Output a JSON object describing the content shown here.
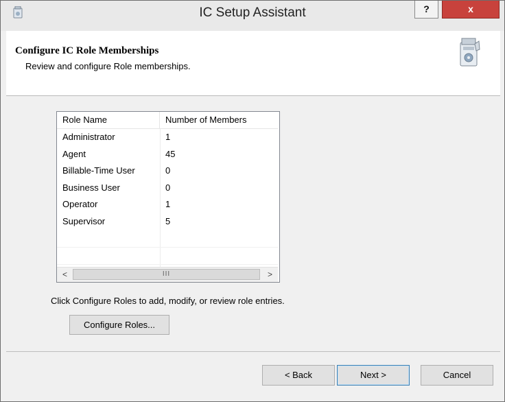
{
  "window": {
    "title": "IC Setup Assistant",
    "help_label": "?",
    "close_label": "x"
  },
  "header": {
    "title": "Configure IC Role Memberships",
    "subtitle": "Review and configure Role memberships."
  },
  "table": {
    "columns": [
      "Role Name",
      "Number of Members"
    ],
    "rows": [
      [
        "Administrator",
        "1"
      ],
      [
        "Agent",
        "45"
      ],
      [
        "Billable-Time User",
        "0"
      ],
      [
        "Business User",
        "0"
      ],
      [
        "Operator",
        "1"
      ],
      [
        "Supervisor",
        "5"
      ]
    ],
    "scroll_left": "<",
    "scroll_right": ">",
    "scroll_thumb": "III"
  },
  "instruction": "Click Configure Roles to add, modify, or review role entries.",
  "configure_button": "Configure Roles...",
  "footer": {
    "back": "< Back",
    "next": "Next >",
    "cancel": "Cancel"
  }
}
